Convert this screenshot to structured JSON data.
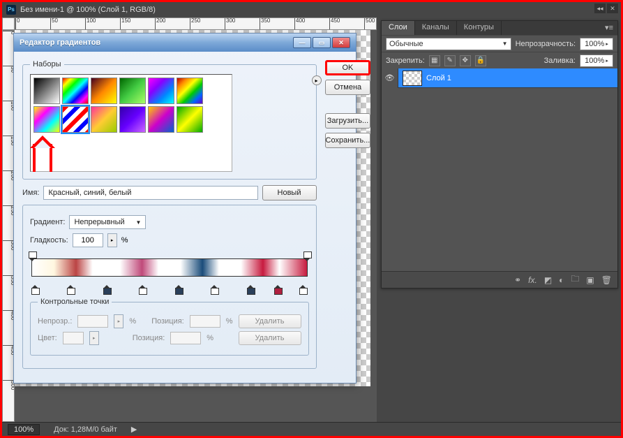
{
  "title": "Без имени-1 @ 100% (Слой 1, RGB/8)",
  "ps": "Ps",
  "status": {
    "zoom": "100%",
    "doc": "Док: 1,28M/0 байт"
  },
  "ruler_top": [
    "0",
    "50",
    "100",
    "150",
    "200",
    "250",
    "300",
    "350",
    "400",
    "450",
    "500"
  ],
  "ruler_left": [
    "0",
    "50",
    "100",
    "150",
    "200",
    "250",
    "300",
    "350",
    "400",
    "450",
    "500"
  ],
  "panel": {
    "tabs": [
      "Слои",
      "Каналы",
      "Контуры"
    ],
    "blend": "Обычные",
    "opacity_label": "Непрозрачность:",
    "opacity_val": "100%",
    "lock_label": "Закрепить:",
    "fill_label": "Заливка:",
    "fill_val": "100%",
    "layer": "Слой 1"
  },
  "dialog": {
    "title": "Редактор градиентов",
    "ok": "OK",
    "cancel": "Отмена",
    "load": "Загрузить...",
    "save": "Сохранить...",
    "presets_label": "Наборы",
    "name_label": "Имя:",
    "name_value": "Красный, синий, белый",
    "new_btn": "Новый",
    "gtype_label": "Градиент:",
    "gtype_value": "Непрерывный",
    "smooth_label": "Гладкость:",
    "smooth_value": "100",
    "pct": "%",
    "cp_label": "Контрольные точки",
    "opac_label": "Непрозр.:",
    "pos_label": "Позиция:",
    "color_label": "Цвет:",
    "delete": "Удалить"
  },
  "swatches": [
    "linear-gradient(135deg,#000,#555,#aaa,#fff)",
    "linear-gradient(135deg,#f00,#ff0,#0f0,#0ff,#00f,#f0f,#f00)",
    "linear-gradient(135deg,#402,#f80,#ff0)",
    "linear-gradient(135deg,#060,#4c4,#af6)",
    "linear-gradient(135deg,#f0f,#80f,#08f,#0ff)",
    "linear-gradient(135deg,#b00,#f80,#ff0,#0c0,#06f,#60c)",
    "linear-gradient(135deg,#ff0,#f0f,#0ff,#ff0)",
    "repeating-linear-gradient(135deg,#f00 0 6px,#fff 6px 12px,#00f 12px 18px,#fff 18px 24px)",
    "linear-gradient(135deg,#f39,#fc3,#9c0)",
    "linear-gradient(135deg,#30a,#60f,#c6f)",
    "linear-gradient(135deg,#fc0,#c0c,#06c)",
    "linear-gradient(135deg,#0a0,#ff0,#0a0)"
  ],
  "selected_swatch": 7
}
